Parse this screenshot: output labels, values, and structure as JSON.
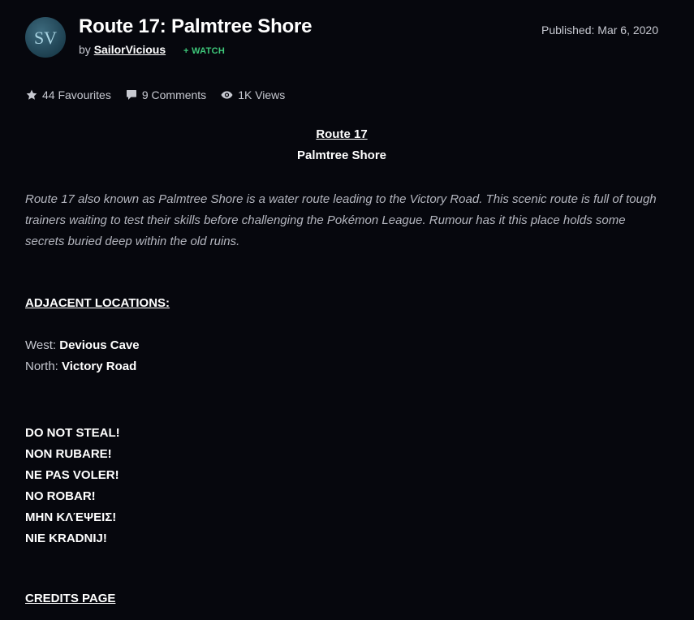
{
  "header": {
    "avatar_initials": "SV",
    "title": "Route 17: Palmtree Shore",
    "by_prefix": "by",
    "author": "SailorVicious",
    "watch_label": "+ WATCH",
    "published": "Published: Mar 6, 2020"
  },
  "stats": {
    "favourites": "44 Favourites",
    "comments": "9 Comments",
    "views": "1K Views"
  },
  "content": {
    "heading_1": "Route 17",
    "heading_2": "Palmtree Shore",
    "description": "Route 17 also known as Palmtree Shore is a water route leading to the Victory Road. This scenic route is full of tough trainers waiting to test their skills before challenging the Pokémon League. Rumour has it this place holds some secrets buried deep within the old ruins.",
    "adjacent_label": "ADJACENT LOCATIONS:",
    "west_label": "West:",
    "west_value": "Devious Cave",
    "north_label": "North:",
    "north_value": "Victory Road",
    "warnings": [
      "DO NOT STEAL!",
      "NON RUBARE!",
      "NE PAS VOLER!",
      "NO ROBAR!",
      "ΜΗΝ ΚΛΈΨΕΙΣ!",
      "NIE KRADNIJ!"
    ],
    "credits_label": "CREDITS PAGE"
  },
  "colors": {
    "background": "#06070d",
    "watch_green": "#3ec77a",
    "muted_text": "#c7c9d1"
  }
}
